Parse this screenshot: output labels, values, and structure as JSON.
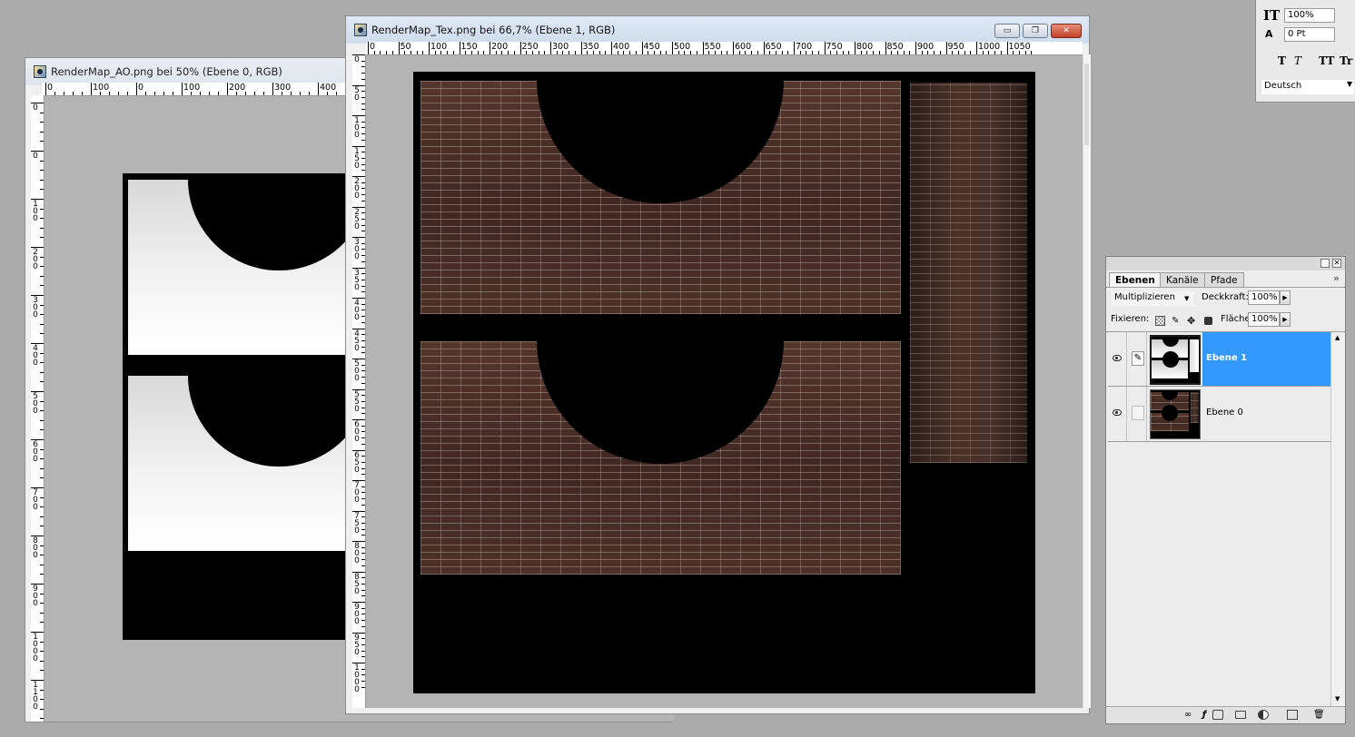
{
  "ao_window": {
    "title": "RenderMap_AO.png bei 50% (Ebene 0, RGB)",
    "ruler_h": [
      "0",
      "100",
      "0",
      "100",
      "200",
      "300",
      "400"
    ],
    "ruler_v": [
      "0",
      "0",
      "100",
      "200",
      "300",
      "400",
      "500",
      "600",
      "700",
      "800",
      "900",
      "1000",
      "1100"
    ]
  },
  "tex_window": {
    "title": "RenderMap_Tex.png bei 66,7% (Ebene 1, RGB)",
    "ruler_h": [
      "0",
      "50",
      "100",
      "150",
      "200",
      "250",
      "300",
      "350",
      "400",
      "450",
      "500",
      "550",
      "600",
      "650",
      "700",
      "750",
      "800",
      "850",
      "900",
      "950",
      "1000",
      "1050"
    ],
    "ruler_v": [
      "0",
      "50",
      "100",
      "150",
      "200",
      "250",
      "300",
      "350",
      "400",
      "450",
      "500",
      "550",
      "600",
      "650",
      "700",
      "750",
      "800",
      "850",
      "900",
      "950",
      "1000"
    ],
    "buttons": {
      "minimize": "▭",
      "maximize": "❐",
      "close": "✕"
    }
  },
  "character_panel": {
    "scale_value": "100%",
    "baseline_value": "0 Pt",
    "language": "Deutsch",
    "style_buttons": [
      "T",
      "T",
      "TT",
      "Tr"
    ],
    "baseline_label": "A",
    "scale_label": "IT"
  },
  "layers_panel": {
    "tabs": [
      "Ebenen",
      "Kanäle",
      "Pfade"
    ],
    "active_tab": "Ebenen",
    "blend_mode": "Multiplizieren",
    "opacity_label": "Deckkraft:",
    "opacity_value": "100%",
    "lock_label": "Fixieren:",
    "fill_label": "Fläche",
    "fill_value": "100%",
    "menu_icon": "»",
    "layers": [
      {
        "name": "Ebene 1",
        "selected": true,
        "visible": true
      },
      {
        "name": "Ebene 0",
        "selected": false,
        "visible": true
      }
    ]
  }
}
